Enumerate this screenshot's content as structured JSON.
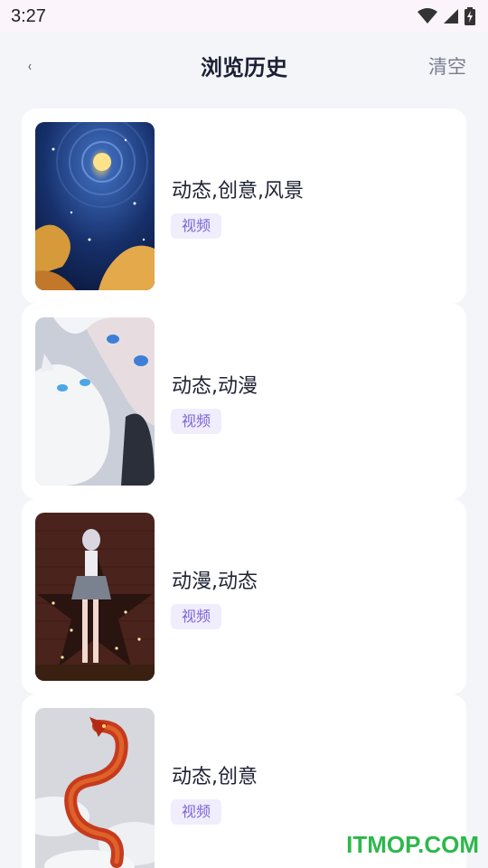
{
  "status_bar": {
    "time": "3:27",
    "icons": [
      "wifi-icon",
      "cellular-signal-icon",
      "battery-charging-icon"
    ]
  },
  "header": {
    "title": "浏览历史",
    "back_icon": "back-arrow-icon",
    "clear_label": "清空"
  },
  "history": [
    {
      "title": "动态,创意,风景",
      "tag": "视频",
      "thumbnail": "starry-night-painting"
    },
    {
      "title": "动态,动漫",
      "tag": "视频",
      "thumbnail": "anime-girl-with-white-cat"
    },
    {
      "title": "动漫,动态",
      "tag": "视频",
      "thumbnail": "anime-girl-brick-wall-stage"
    },
    {
      "title": "动态,创意",
      "tag": "视频",
      "thumbnail": "red-dragon-clouds"
    }
  ],
  "watermark": "ITMOP.COM",
  "colors": {
    "accent_tag_text": "#7b66d6",
    "accent_tag_bg": "#f0edfd",
    "page_bg": "#f4f5f9",
    "watermark": "#2db84b"
  }
}
